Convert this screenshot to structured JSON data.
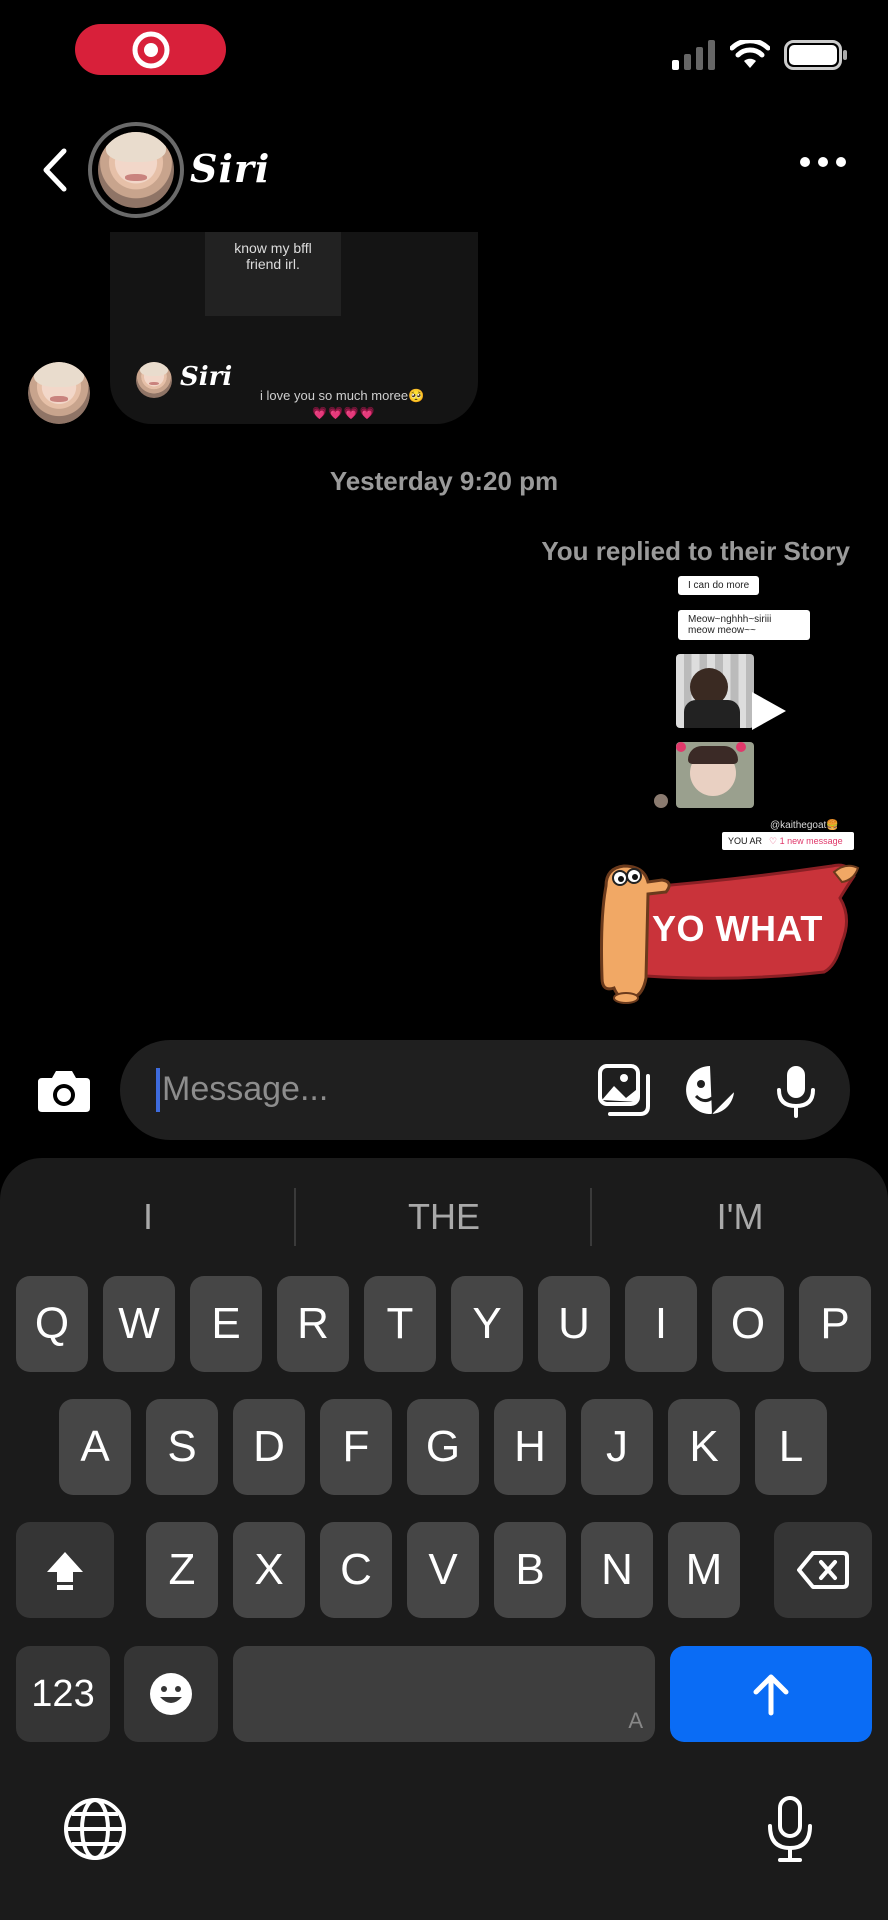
{
  "header": {
    "name": "Siri"
  },
  "shared_story": {
    "overlay_text": "know my bffl\nfriend irl.",
    "username": "Siri",
    "caption": "i love you so much moree🥺",
    "hearts": "💗💗💗💗"
  },
  "conversation": {
    "timestamp": "Yesterday 9:20 pm",
    "replied_label": "You replied to their Story"
  },
  "story_preview": {
    "chip1": "I can do more",
    "chip2": "Meow~nghhh~siriii meow meow~~",
    "handle": "@kaithegoat🍔",
    "bar_text": "YOU AR",
    "new_message": "♡ 1 new message"
  },
  "sticker": {
    "label": "YO WHAT"
  },
  "composer": {
    "placeholder": "Message..."
  },
  "keyboard": {
    "suggestions": [
      "I",
      "THE",
      "I'M"
    ],
    "row1": [
      "Q",
      "W",
      "E",
      "R",
      "T",
      "Y",
      "U",
      "I",
      "O",
      "P"
    ],
    "row2": [
      "A",
      "S",
      "D",
      "F",
      "G",
      "H",
      "J",
      "K",
      "L"
    ],
    "row3": [
      "Z",
      "X",
      "C",
      "V",
      "B",
      "N",
      "M"
    ],
    "numbers_label": "123",
    "space_hint": "A"
  },
  "colors": {
    "status_pill": "#d8203a",
    "send_key": "#0a6cf5",
    "sticker_red": "#c9333a",
    "sticker_dog": "#f1a865"
  }
}
